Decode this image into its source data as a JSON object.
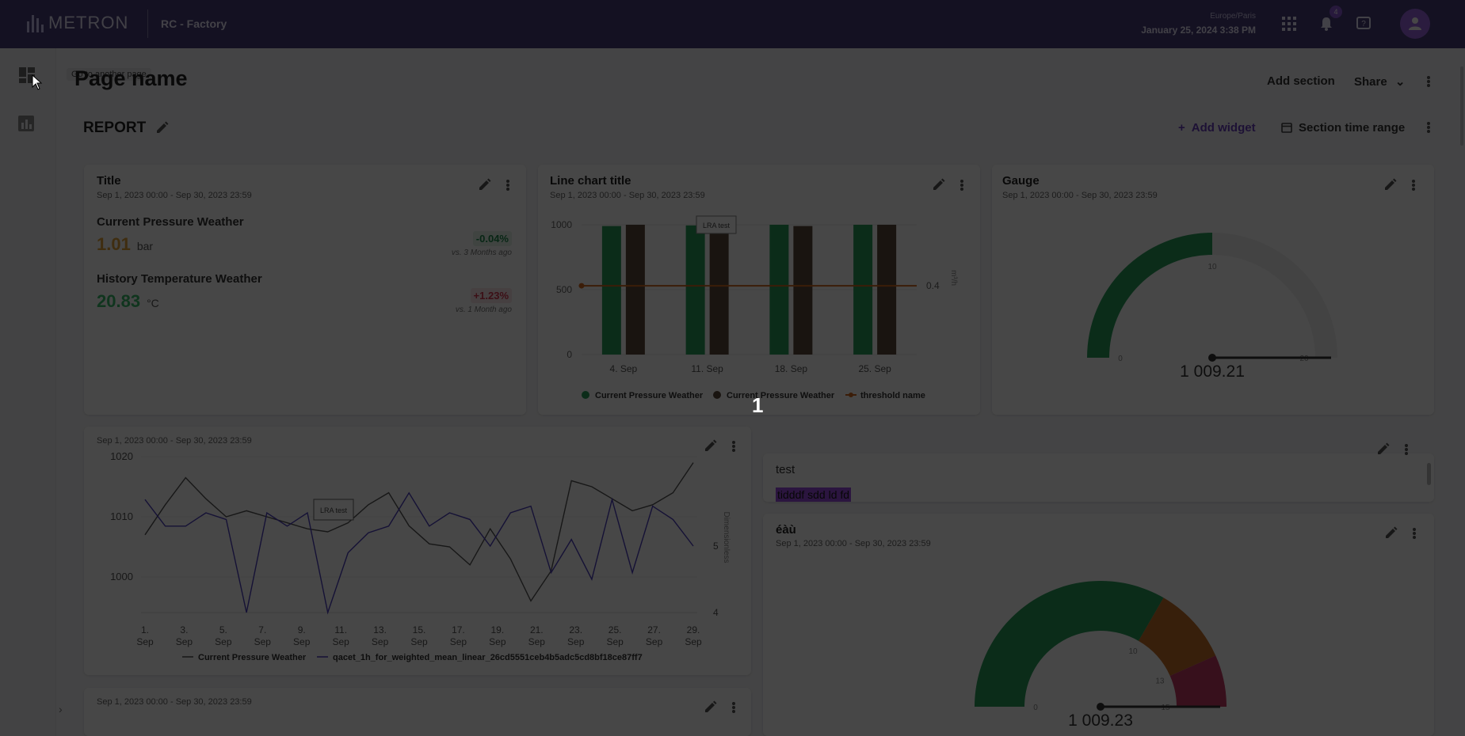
{
  "header": {
    "logo_text": "METRON",
    "factory": "RC - Factory",
    "timezone": "Europe/Paris",
    "datetime": "January 25, 2024 3:38 PM",
    "notification_count": "4",
    "colors": {
      "bar": "#4a3d7c",
      "accent": "#8e5bd8"
    }
  },
  "sidebar": {
    "tooltip": "Go to another page",
    "icons": [
      "dashboard-icon",
      "chart-icon"
    ]
  },
  "page": {
    "title": "Page name",
    "add_section": "Add section",
    "share": "Share"
  },
  "section": {
    "title": "REPORT",
    "add_widget": "Add widget",
    "time_range": "Section time range"
  },
  "kpi_widget": {
    "title": "Title",
    "date_range": "Sep 1, 2023 00:00 - Sep 30, 2023 23:59",
    "items": [
      {
        "label": "Current Pressure Weather",
        "value": "1.01",
        "unit": "bar",
        "delta": "-0.04%",
        "comparison": "vs. 3 Months ago",
        "value_color": "#e0a33c",
        "delta_color": "#1e8a4c",
        "delta_bg": "#e4f4ea"
      },
      {
        "label": "History Temperature Weather",
        "value": "20.83",
        "unit": "°C",
        "delta": "+1.23%",
        "comparison": "vs. 1 Month ago",
        "value_color": "#3bbf6b",
        "delta_color": "#d6364f",
        "delta_bg": "#fbe7ea"
      }
    ]
  },
  "bar_widget": {
    "title": "Line chart title",
    "date_range": "Sep 1, 2023 00:00 - Sep 30, 2023 23:59",
    "annotation": "LRA test",
    "right_axis_label": "m³/h",
    "right_tick": "0.4",
    "legend": [
      "Current Pressure Weather",
      "Current Pressure Weather",
      "threshold name"
    ]
  },
  "gauge_widget": {
    "title": "Gauge",
    "date_range": "Sep 1, 2023 00:00 - Sep 30, 2023 23:59",
    "value_label": "1 009.21",
    "ticks": [
      "0",
      "10",
      "20"
    ]
  },
  "line_widget": {
    "date_range": "Sep 1, 2023 00:00 - Sep 30, 2023 23:59",
    "annotation": "LRA test",
    "right_axis_label": "Dimensionless",
    "legend": [
      "Current Pressure Weather",
      "qacet_1h_for_weighted_mean_linear_26cd5551ceb4b5adc5cd8bf18ce87ff7"
    ]
  },
  "text_widget": {
    "text": "test",
    "highlight": "tidddf sdd ld  fd"
  },
  "gauge2_widget": {
    "title": "éàù",
    "date_range": "Sep 1, 2023 00:00 - Sep 30, 2023 23:59",
    "value_label": "1 009.23",
    "ticks": [
      "0",
      "10",
      "13",
      "15"
    ]
  },
  "bottom_widget": {
    "date_range": "Sep 1, 2023 00:00 - Sep 30, 2023 23:59"
  },
  "overlay": {
    "step_number": "1"
  },
  "chart_data": [
    {
      "type": "bar",
      "title": "Line chart title",
      "categories": [
        "4. Sep",
        "11. Sep",
        "18. Sep",
        "25. Sep"
      ],
      "ylim": [
        0,
        1000
      ],
      "y_ticks": [
        "0",
        "500",
        "1000"
      ],
      "series": [
        {
          "name": "Current Pressure Weather",
          "values": [
            990,
            995,
            1000,
            1000
          ],
          "color": "#2a9d5c"
        },
        {
          "name": "Current Pressure Weather",
          "values": [
            1000,
            990,
            990,
            1000
          ],
          "color": "#5c4a3a"
        }
      ],
      "threshold": {
        "name": "threshold name",
        "value": 0.4,
        "left_axis_value": 530,
        "color": "#d2691e"
      }
    },
    {
      "type": "line",
      "x": [
        "1. Sep",
        "3. Sep",
        "5. Sep",
        "7. Sep",
        "9. Sep",
        "11. Sep",
        "13. Sep",
        "15. Sep",
        "17. Sep",
        "19. Sep",
        "21. Sep",
        "23. Sep",
        "25. Sep",
        "27. Sep",
        "29. Sep"
      ],
      "x_ticks": [
        "1.",
        "3.",
        "5.",
        "7.",
        "9.",
        "11.",
        "13.",
        "15.",
        "17.",
        "19.",
        "21.",
        "23.",
        "25.",
        "27.",
        "29."
      ],
      "x_tick_sub": "Sep",
      "y_left": [
        1000,
        1020
      ],
      "y_left_ticks": [
        "1000",
        "1010",
        "1020"
      ],
      "y_right": [
        4,
        6
      ],
      "y_right_ticks": [
        "4",
        "5"
      ],
      "series": [
        {
          "name": "Current Pressure Weather",
          "axis": "left",
          "color": "#555555",
          "values": [
            1007,
            1012,
            1016.5,
            1013,
            1010,
            1011,
            1010,
            1009,
            1008,
            1007.5,
            1009,
            1012,
            1014,
            1008.5,
            1005.5,
            1005,
            1002,
            1008,
            1003,
            996,
            1001,
            1016,
            1015,
            1013,
            1011,
            1012,
            1014,
            1019
          ]
        },
        {
          "name": "qacet_1h_for_weighted_mean_linear_26cd5551ceb4b5adc5cd8bf18ce87ff7",
          "axis": "right",
          "color": "#4b3dbf",
          "values": [
            5.7,
            5.3,
            5.3,
            5.5,
            5.4,
            4.0,
            5.5,
            5.3,
            5.5,
            4.0,
            4.9,
            5.2,
            5.3,
            5.8,
            5.3,
            5.5,
            5.4,
            5.0,
            5.5,
            5.6,
            4.6,
            5.1,
            4.5,
            5.7,
            4.6,
            5.6,
            5.4,
            5.0
          ]
        }
      ]
    },
    {
      "type": "gauge",
      "title": "Gauge",
      "value": 1009.21,
      "range": [
        0,
        20
      ],
      "bands": [
        {
          "from": 0,
          "to": 10,
          "color": "#2a9d5c"
        }
      ]
    },
    {
      "type": "gauge",
      "title": "éàù",
      "value": 1009.23,
      "range": [
        0,
        15
      ],
      "bands": [
        {
          "from": 0,
          "to": 10,
          "color": "#2a9d5c"
        },
        {
          "from": 10,
          "to": 13,
          "color": "#c66f2a"
        },
        {
          "from": 13,
          "to": 15,
          "color": "#c43a64"
        }
      ]
    }
  ]
}
